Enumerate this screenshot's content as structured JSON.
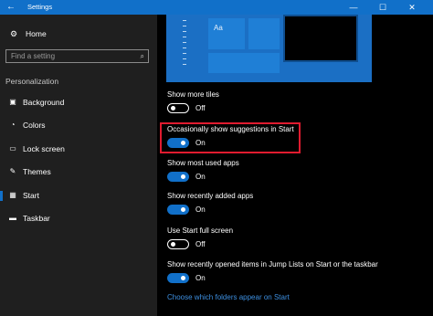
{
  "window": {
    "title": "Settings",
    "back_glyph": "←",
    "minimize_glyph": "—",
    "maximize_glyph": "☐",
    "close_glyph": "✕",
    "accent_color": "#1170c9"
  },
  "sidebar": {
    "home_label": "Home",
    "home_icon": "gear-icon",
    "search_placeholder": "Find a setting",
    "section_title": "Personalization",
    "items": [
      {
        "label": "Background",
        "icon": "picture-icon"
      },
      {
        "label": "Colors",
        "icon": "palette-icon"
      },
      {
        "label": "Lock screen",
        "icon": "lock-screen-icon"
      },
      {
        "label": "Themes",
        "icon": "brush-icon"
      },
      {
        "label": "Start",
        "icon": "start-icon",
        "selected": true
      },
      {
        "label": "Taskbar",
        "icon": "taskbar-icon"
      }
    ]
  },
  "preview": {
    "tile_text": "Aa"
  },
  "settings": [
    {
      "label": "Show more tiles",
      "state": "Off"
    },
    {
      "label": "Occasionally show suggestions in Start",
      "state": "On",
      "highlighted": true
    },
    {
      "label": "Show most used apps",
      "state": "On"
    },
    {
      "label": "Show recently added apps",
      "state": "On"
    },
    {
      "label": "Use Start full screen",
      "state": "Off"
    },
    {
      "label": "Show recently opened items in Jump Lists on Start or the taskbar",
      "state": "On"
    }
  ],
  "link_text": "Choose which folders appear on Start",
  "highlight_color": "#e01b2f"
}
